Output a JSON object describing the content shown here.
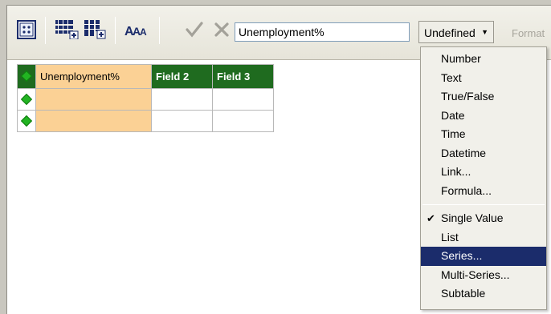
{
  "toolbar": {
    "name_value": "Unemployment%",
    "type_dropdown": {
      "selected": "Undefined"
    },
    "format_label": "Format"
  },
  "grid": {
    "headers": [
      "Unemployment%",
      "Field 2",
      "Field 3"
    ],
    "rows": [
      [
        "",
        "",
        ""
      ],
      [
        "",
        "",
        ""
      ]
    ]
  },
  "type_menu": {
    "data_types": [
      "Number",
      "Text",
      "True/False",
      "Date",
      "Time",
      "Datetime",
      "Link...",
      "Formula..."
    ],
    "structures": [
      "Single Value",
      "List",
      "Series...",
      "Multi-Series...",
      "Subtable"
    ],
    "checked": "Single Value",
    "highlighted": "Series..."
  },
  "colors": {
    "header_green": "#1f6b1f",
    "active_column": "#fbd195",
    "menu_highlight": "#1b2c6b",
    "row_marker": "#22b422"
  },
  "icons": [
    "insert-grid-icon",
    "add-rows-icon",
    "add-columns-icon",
    "text-format-icon",
    "accept-check-icon",
    "cancel-x-icon",
    "chevron-down-icon",
    "row-marker-icon"
  ]
}
